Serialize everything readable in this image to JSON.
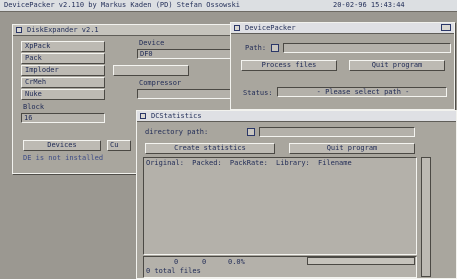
{
  "screen": {
    "title": "DevicePacker v2.110 by Markus Kaden (PD) Stefan Ossowski",
    "datetime": "20-02-96 15:43:44"
  },
  "disk_expander": {
    "title": "DiskExpander v2.1",
    "methods": [
      "XpPack",
      "Pack",
      "Imploder",
      "CrMeh",
      "Nuke"
    ],
    "block_label": "Block",
    "block_value": "16",
    "device_label": "Device",
    "device_value": "DF0",
    "compressor_label": "Compressor",
    "compressor_value": "",
    "devices_button": "Devices",
    "cut_button": "Cu",
    "status_text": "DE is not installed"
  },
  "device_packer": {
    "title": "DevicePacker",
    "path_label": "Path:",
    "path_value": "",
    "process_button": "Process files",
    "quit_button": "Quit program",
    "status_label": "Status:",
    "status_value": "- Please select path -"
  },
  "dc_statistics": {
    "title": "DCStatistics",
    "path_label": "directory path:",
    "path_value": "",
    "create_button": "Create statistics",
    "quit_button": "Quit program",
    "columns": [
      "Original:",
      "Packed:",
      "PackRate:",
      "Library:",
      "Filename"
    ],
    "footer_counts": [
      "0",
      "0",
      "0.0%"
    ],
    "total_files": "0 total files"
  }
}
